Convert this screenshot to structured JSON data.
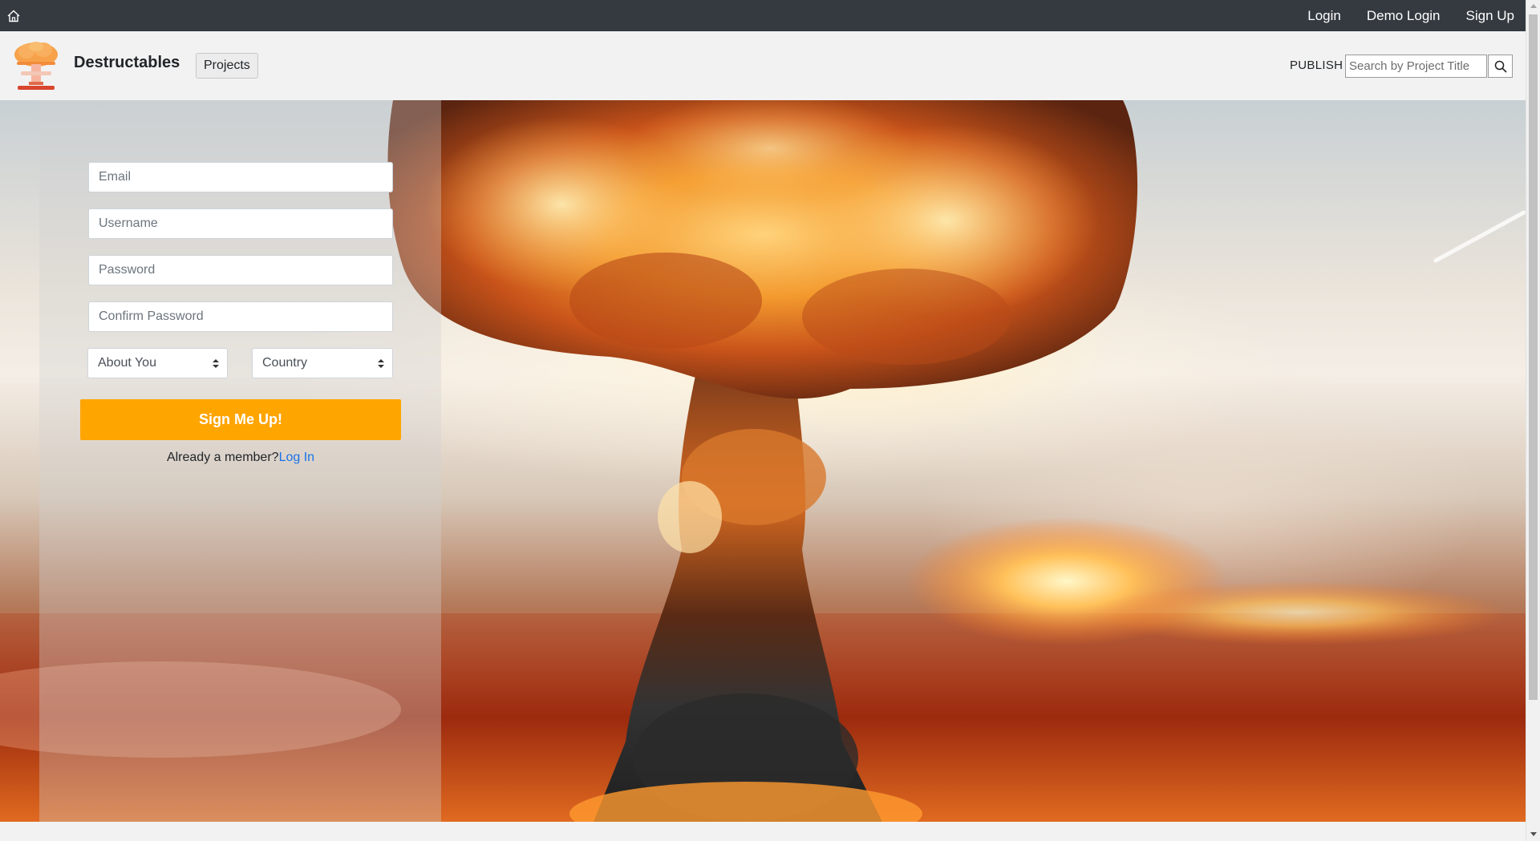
{
  "topnav": {
    "home_icon": "home-icon",
    "links": [
      "Login",
      "Demo Login",
      "Sign Up"
    ]
  },
  "header": {
    "brand": "Destructables",
    "logo_icon": "mushroom-cloud-logo",
    "projects_label": "Projects",
    "publish_label": "PUBLISH",
    "search_placeholder": "Search by Project Title",
    "search_icon": "search-icon"
  },
  "signup_form": {
    "email_placeholder": "Email",
    "username_placeholder": "Username",
    "password_placeholder": "Password",
    "confirm_password_placeholder": "Confirm Password",
    "about_you_selected": "About You",
    "country_selected": "Country",
    "submit_label": "Sign Me Up!",
    "member_prompt": "Already a member?",
    "login_link": "Log In"
  },
  "colors": {
    "topnav_bg": "#343a40",
    "accent": "#ffa500",
    "link": "#1a73e8"
  }
}
